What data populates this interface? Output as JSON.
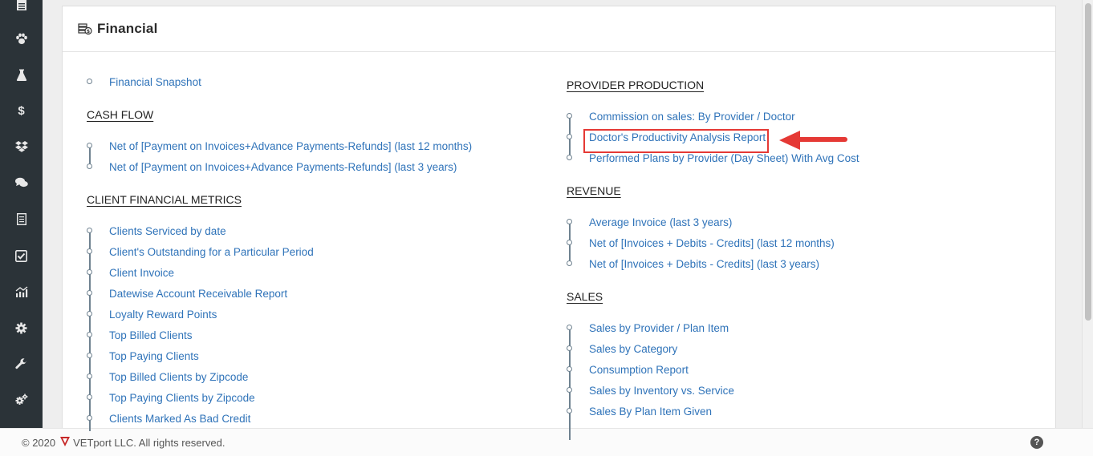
{
  "sidebar": {
    "icons": [
      "calendar-icon",
      "paw-icon",
      "flask-icon",
      "dollar-icon",
      "dropbox-icon",
      "comments-icon",
      "receipt-icon",
      "checkbox-icon",
      "chart-icon",
      "gear-icon",
      "wrench-icon",
      "cogs-icon"
    ]
  },
  "panel": {
    "title": "Financial"
  },
  "left": {
    "snapshot": "Financial Snapshot",
    "cash_flow": {
      "heading": "CASH FLOW",
      "items": [
        "Net of [Payment on Invoices+Advance Payments-Refunds] (last 12 months)",
        "Net of [Payment on Invoices+Advance Payments-Refunds] (last 3 years)"
      ]
    },
    "client_metrics": {
      "heading": "CLIENT FINANCIAL METRICS",
      "items": [
        "Clients Serviced by date",
        "Client's Outstanding for a Particular Period",
        "Client Invoice",
        "Datewise Account Receivable Report",
        "Loyalty Reward Points",
        "Top Billed Clients",
        "Top Paying Clients",
        "Top Billed Clients by Zipcode",
        "Top Paying Clients by Zipcode",
        "Clients Marked As Bad Credit"
      ]
    }
  },
  "right": {
    "provider": {
      "heading": "PROVIDER PRODUCTION",
      "items": [
        "Commission on sales: By Provider / Doctor",
        "Doctor's Productivity Analysis Report",
        "Performed Plans by Provider (Day Sheet) With Avg Cost"
      ]
    },
    "revenue": {
      "heading": "REVENUE",
      "items": [
        "Average Invoice (last 3 years)",
        "Net of [Invoices + Debits - Credits] (last 12 months)",
        "Net of [Invoices + Debits - Credits] (last 3 years)"
      ]
    },
    "sales": {
      "heading": "SALES",
      "items": [
        "Sales by Provider / Plan Item",
        "Sales by Category",
        "Consumption Report",
        "Sales by Inventory vs. Service",
        "Sales By Plan Item Given"
      ]
    }
  },
  "footer": {
    "copyright": "© 2020",
    "company": "VETport LLC. All rights reserved.",
    "help": "?"
  },
  "colors": {
    "link": "#2f73b9",
    "sidebar": "#2b3338",
    "highlight": "#e53935"
  }
}
